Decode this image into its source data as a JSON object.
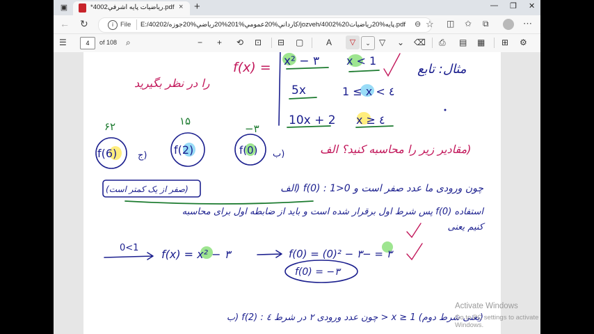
{
  "tab": {
    "title": "*رياضيات پايه اشرفي4002.pdf",
    "close": "×",
    "new_tab": "+"
  },
  "window": {
    "minimize": "—",
    "maximize": "❐",
    "close": "✕"
  },
  "address": {
    "scheme": "File",
    "url": "E:/40202/كارداني%20عمومي%201%20رياضي%20جوزه/jozveh/4002%20پايه%20رياضيات.pdf"
  },
  "pdf_toolbar": {
    "page_current": "4",
    "page_total": "of 108"
  },
  "page": {
    "title_math": "مثال: تابع",
    "case1_expr": "x² − ٣",
    "case1_cond": "x < 1",
    "case2_expr": "5x",
    "case2_cond": "1 ≤ x < ٤",
    "case3_expr": "10x + 2",
    "case3_cond": "x ≥ ٤",
    "fx_label": "f(x) =",
    "fx_desc": "را در نظر بگیرید",
    "question": "مقادیر زیر را محاسبه کنید؟ الف)",
    "q_a": "f(0)",
    "q_b": "f(2)",
    "q_c": "f(6)",
    "q_sep_b": "ب)",
    "q_sep_c": "ج)",
    "ans_a": "−٣",
    "ans_b": "۱۵",
    "ans_c": "۶۲",
    "line1": "الف) f(0) : چون ورودی ما عدد صفر است و 0<1",
    "line1_box": "(صفر از یک کمتر است)",
    "line2": "پس شرط اول برقرار شده است و باید از ضابطه اول برای محاسبه f(0) استفاده",
    "line3": "کنیم یعنی",
    "calc_cond": "0<1",
    "calc_expr": "f(x) = x² − ٣",
    "calc_result": "f(0) = (0)² − ٣ = −٣",
    "calc_final": "f(0) = −٣",
    "line4": "ب) f(2) : چون عدد ورودی ٢ در شرط ٤ > x ≥ 1 (یعنی شرط دوم)"
  },
  "watermark": {
    "line1": "Activate Windows",
    "line2": "Go to PC settings to activate Windows."
  },
  "colors": {
    "ink_blue": "#1b1f8e",
    "ink_red": "#c2185b",
    "ink_green": "#1b7a2e",
    "highlight_green": "#7ddc6b",
    "highlight_blue": "#7fd3f5",
    "highlight_yellow": "#ffe85c"
  },
  "icons": [
    "sidebar-icon",
    "pdf-icon",
    "back-icon",
    "refresh-icon",
    "info-icon",
    "zoom-icon",
    "favorite-icon",
    "split-icon",
    "collections-icon",
    "profile-icon",
    "more-icon",
    "toc-icon",
    "search-icon",
    "zoom-out-icon",
    "zoom-in-icon",
    "rotate-icon",
    "fit-icon",
    "page-view-icon",
    "read-aloud-icon",
    "draw-icon",
    "highlight-icon",
    "eraser-icon",
    "print-icon",
    "save-icon",
    "save-as-icon",
    "settings-icon"
  ]
}
